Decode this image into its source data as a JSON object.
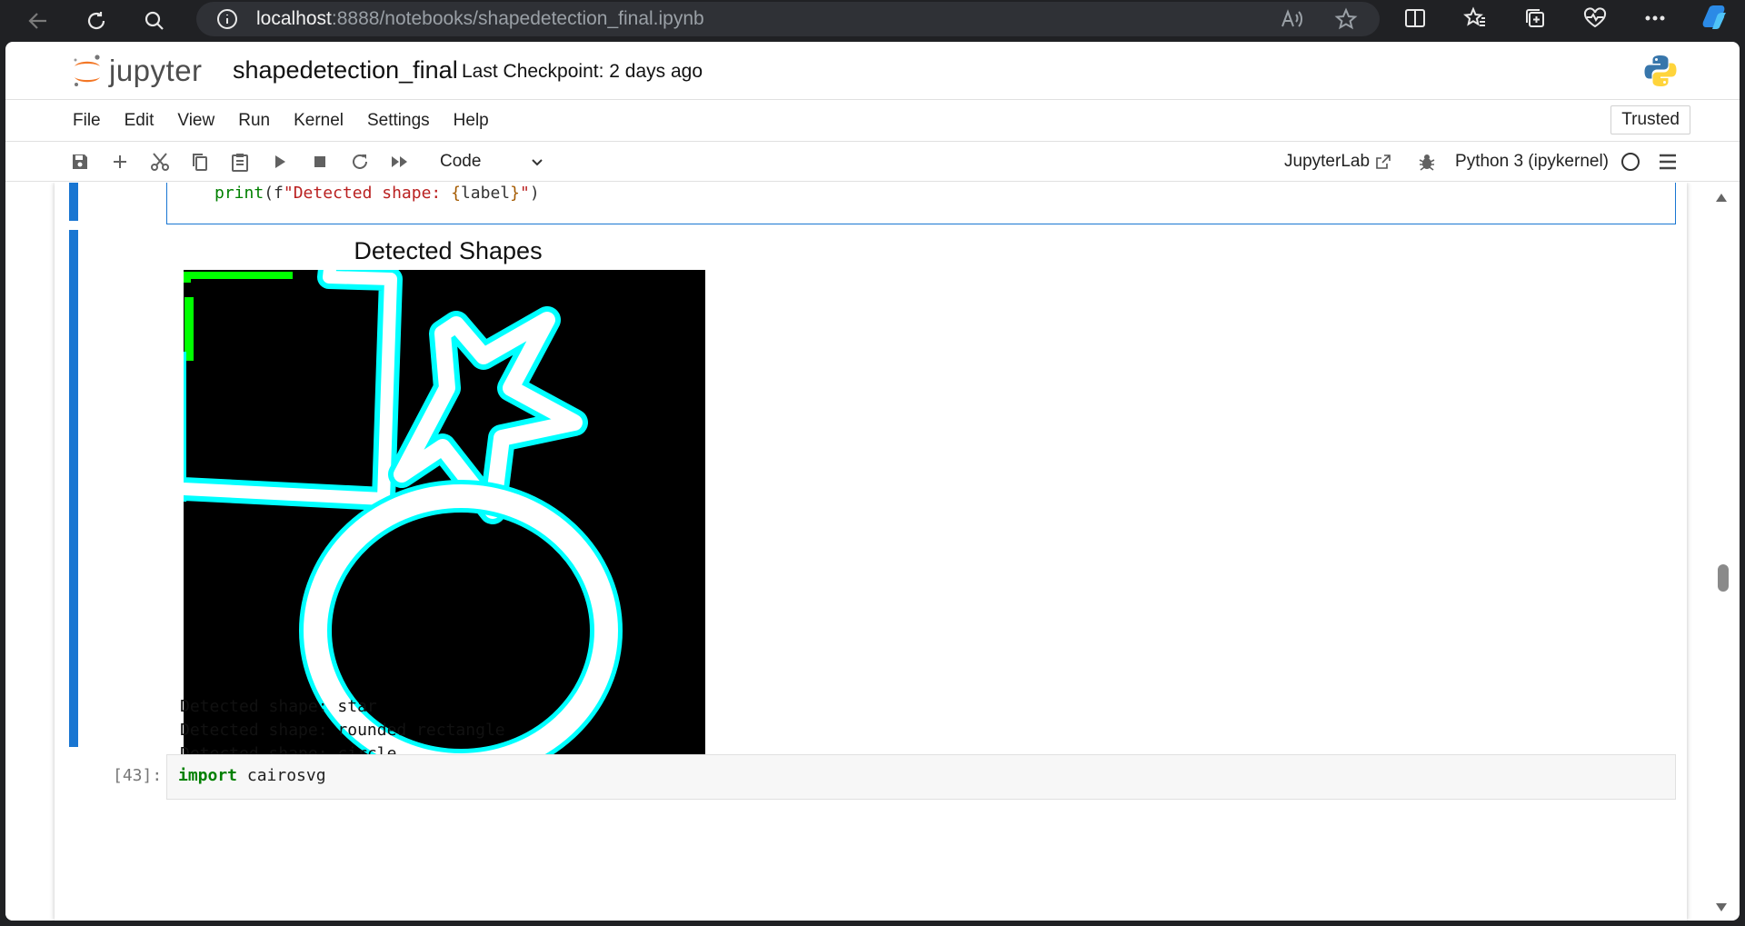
{
  "browser": {
    "url_host": "localhost",
    "url_rest": ":8888/notebooks/shapedetection_final.ipynb"
  },
  "header": {
    "logo_text": "jupyter",
    "notebook_title": "shapedetection_final",
    "checkpoint": "Last Checkpoint: 2 days ago"
  },
  "menu": {
    "items": [
      "File",
      "Edit",
      "View",
      "Run",
      "Kernel",
      "Settings",
      "Help"
    ],
    "trusted": "Trusted"
  },
  "toolbar": {
    "cell_type": "Code",
    "jupyterlab_link": "JupyterLab",
    "kernel_name": "Python 3 (ipykernel)"
  },
  "cells": {
    "cell1_code_print": "print",
    "cell1_code_open": "(",
    "cell1_code_fprefix": "f",
    "cell1_code_str1": "\"Detected shape: ",
    "cell1_code_brace_open": "{",
    "cell1_code_var": "label",
    "cell1_code_brace_close": "}",
    "cell1_code_str2": "\"",
    "cell1_code_close": ")",
    "figure_title": "Detected Shapes",
    "output_lines": [
      "Detected shape: star",
      "Detected shape: rounded rectangle",
      "Detected shape: circle"
    ],
    "cell2_prompt": "[43]:",
    "cell2_keyword": "import",
    "cell2_rest": " cairosvg"
  },
  "colors": {
    "contour": "#00ffff",
    "rect_box": "#00ff00",
    "accent": "#1976d2"
  }
}
